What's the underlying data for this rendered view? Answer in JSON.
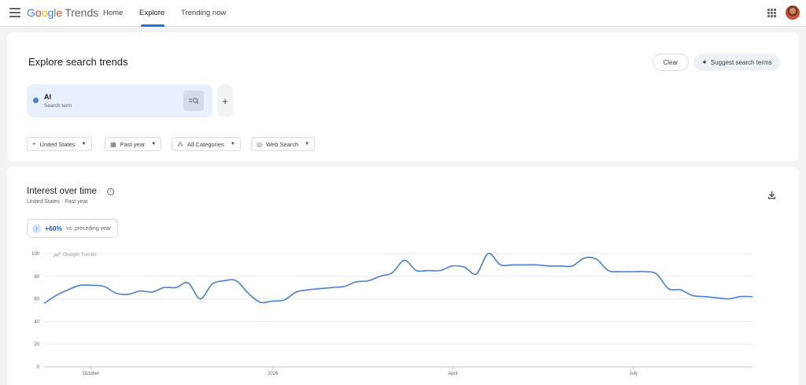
{
  "app": {
    "logo_google": [
      "G",
      "o",
      "o",
      "g",
      "l",
      "e"
    ],
    "logo_product": "Trends"
  },
  "nav": {
    "tabs": [
      {
        "label": "Home",
        "active": false
      },
      {
        "label": "Explore",
        "active": true
      },
      {
        "label": "Trending now",
        "active": false
      }
    ]
  },
  "explore": {
    "title": "Explore search trends",
    "clear_label": "Clear",
    "suggest_label": "Suggest search terms",
    "term": {
      "name": "AI",
      "type": "Search term",
      "color": "#4a7fd4"
    },
    "filters": [
      {
        "label": "United States",
        "icon": "location-pin-icon"
      },
      {
        "label": "Past year",
        "icon": "calendar-icon"
      },
      {
        "label": "All Categories",
        "icon": "categories-icon"
      },
      {
        "label": "Web Search",
        "icon": "globe-icon"
      }
    ]
  },
  "interest": {
    "title": "Interest over time",
    "subtitle": "United States · Past year",
    "change_value": "+60%",
    "change_label": "vs. preceding year"
  },
  "chart_data": {
    "type": "line",
    "watermark": "Google Trends",
    "ylim": [
      0,
      100
    ],
    "yticks": [
      0,
      20,
      40,
      60,
      80,
      100
    ],
    "xticks": [
      {
        "label": "October",
        "pos": 0.066
      },
      {
        "label": "2026",
        "pos": 0.323
      },
      {
        "label": "April",
        "pos": 0.577
      },
      {
        "label": "July",
        "pos": 0.832
      }
    ],
    "series": [
      {
        "color": "#4a7fd4",
        "values": [
          56,
          63,
          68,
          72,
          72,
          71,
          65,
          64,
          67,
          66,
          70,
          70,
          74,
          60,
          73,
          76,
          76,
          65,
          57,
          58,
          59,
          66,
          68,
          69,
          70,
          71,
          75,
          76,
          80,
          83,
          94,
          85,
          85,
          85,
          89,
          88,
          82,
          100,
          90,
          90,
          90,
          90,
          89,
          89,
          89,
          96,
          95,
          85,
          84,
          84,
          84,
          82,
          69,
          68,
          63,
          62,
          61,
          60,
          62,
          62
        ]
      }
    ]
  }
}
